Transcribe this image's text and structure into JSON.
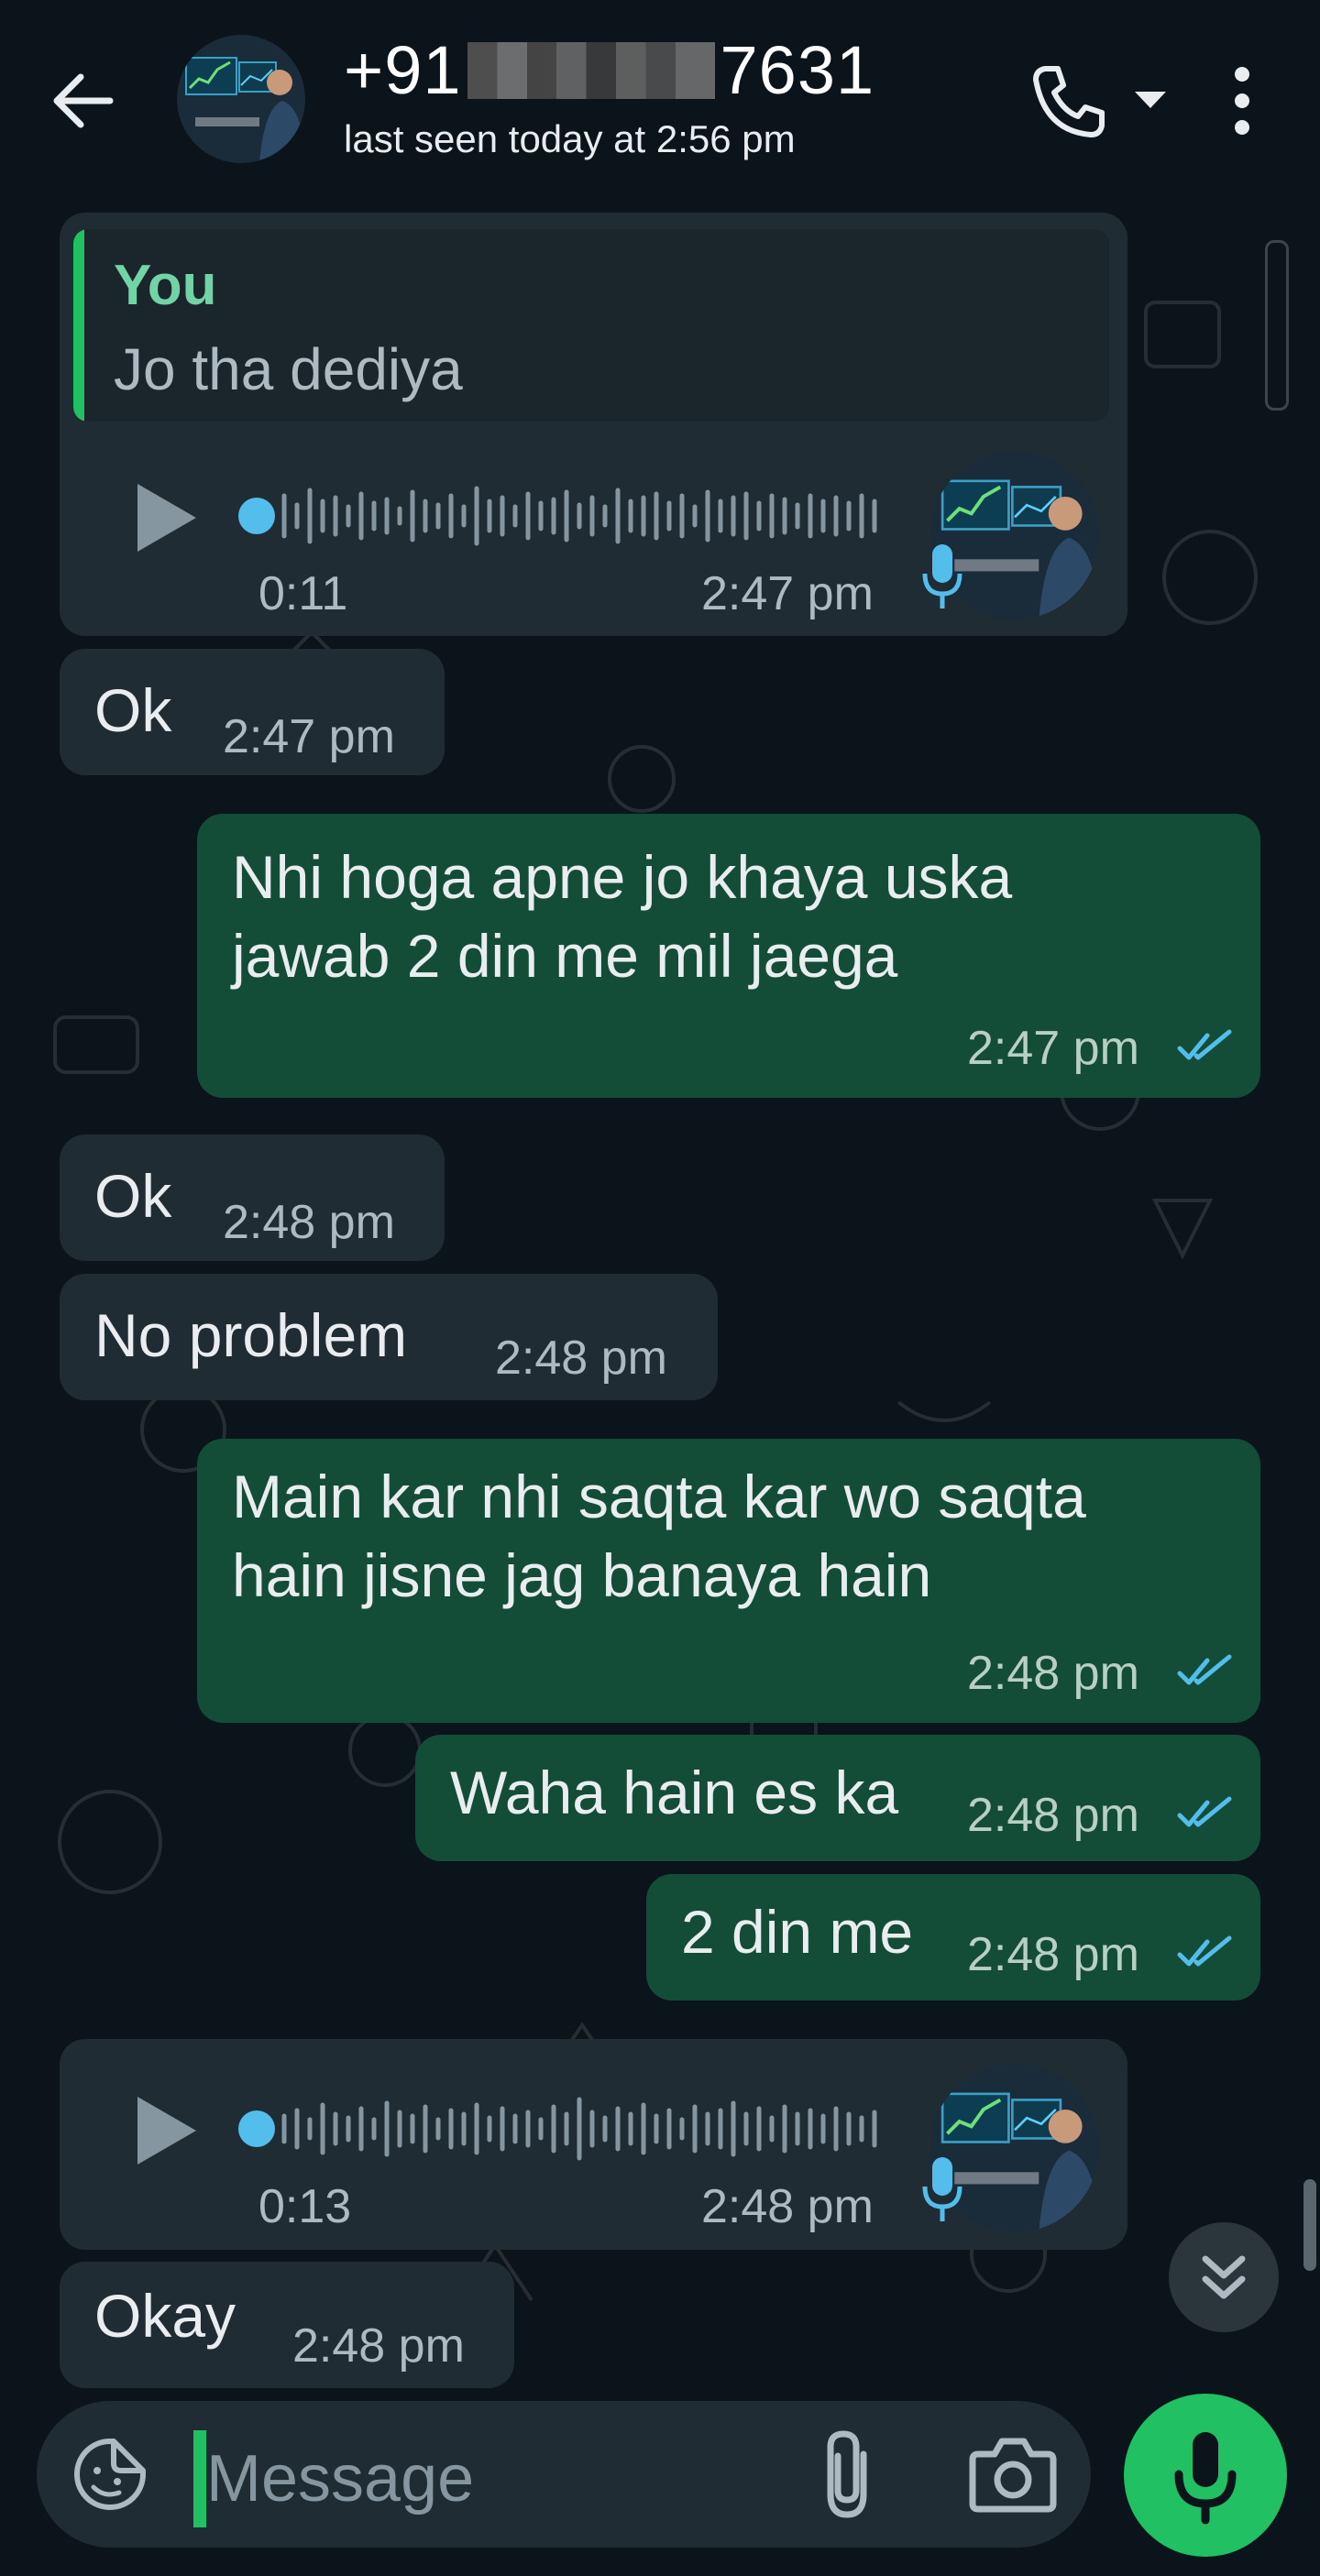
{
  "header": {
    "title_prefix": "+91",
    "title_suffix": "7631",
    "status": "last seen today at 2:56 pm"
  },
  "messages": [
    {
      "direction": "in",
      "type": "voice",
      "quote": {
        "author": "You",
        "text": "Jo tha dediya"
      },
      "duration": "0:11",
      "time": "2:47 pm"
    },
    {
      "direction": "in",
      "type": "text",
      "lines": [
        "Ok"
      ],
      "time": "2:47 pm"
    },
    {
      "direction": "out",
      "type": "text",
      "lines": [
        "Nhi hoga apne jo khaya uska",
        "jawab 2 din me mil jaega"
      ],
      "time": "2:47 pm",
      "read": true
    },
    {
      "direction": "in",
      "type": "text",
      "lines": [
        "Ok"
      ],
      "time": "2:48 pm"
    },
    {
      "direction": "in",
      "type": "text",
      "lines": [
        "No problem"
      ],
      "time": "2:48 pm"
    },
    {
      "direction": "out",
      "type": "text",
      "lines": [
        "Main kar nhi saqta kar wo saqta",
        "hain jisne jag banaya hain"
      ],
      "time": "2:48 pm",
      "read": true
    },
    {
      "direction": "out",
      "type": "text",
      "lines": [
        "Waha hain es ka"
      ],
      "time": "2:48 pm",
      "read": true
    },
    {
      "direction": "out",
      "type": "text",
      "lines": [
        "2 din me"
      ],
      "time": "2:48 pm",
      "read": true
    },
    {
      "direction": "in",
      "type": "voice",
      "duration": "0:13",
      "time": "2:48 pm"
    },
    {
      "direction": "in",
      "type": "text",
      "lines": [
        "Okay"
      ],
      "time": "2:48 pm"
    }
  ],
  "composer": {
    "placeholder": "Message"
  },
  "colors": {
    "background": "#0b141a",
    "incoming_bubble": "#202c33",
    "outgoing_bubble": "#144d37",
    "accent_green": "#21c063",
    "read_ticks": "#53bdeb",
    "voice_dot": "#53bdeb"
  },
  "icons": {
    "back": "arrow-left-icon",
    "call": "phone-icon",
    "call_options": "caret-down-icon",
    "menu": "more-vertical-icon",
    "play": "play-icon",
    "mic_badge": "microphone-icon",
    "scroll_down": "double-chevron-down-icon",
    "sticker": "sticker-icon",
    "attach": "paperclip-icon",
    "camera": "camera-icon",
    "record": "microphone-icon"
  }
}
